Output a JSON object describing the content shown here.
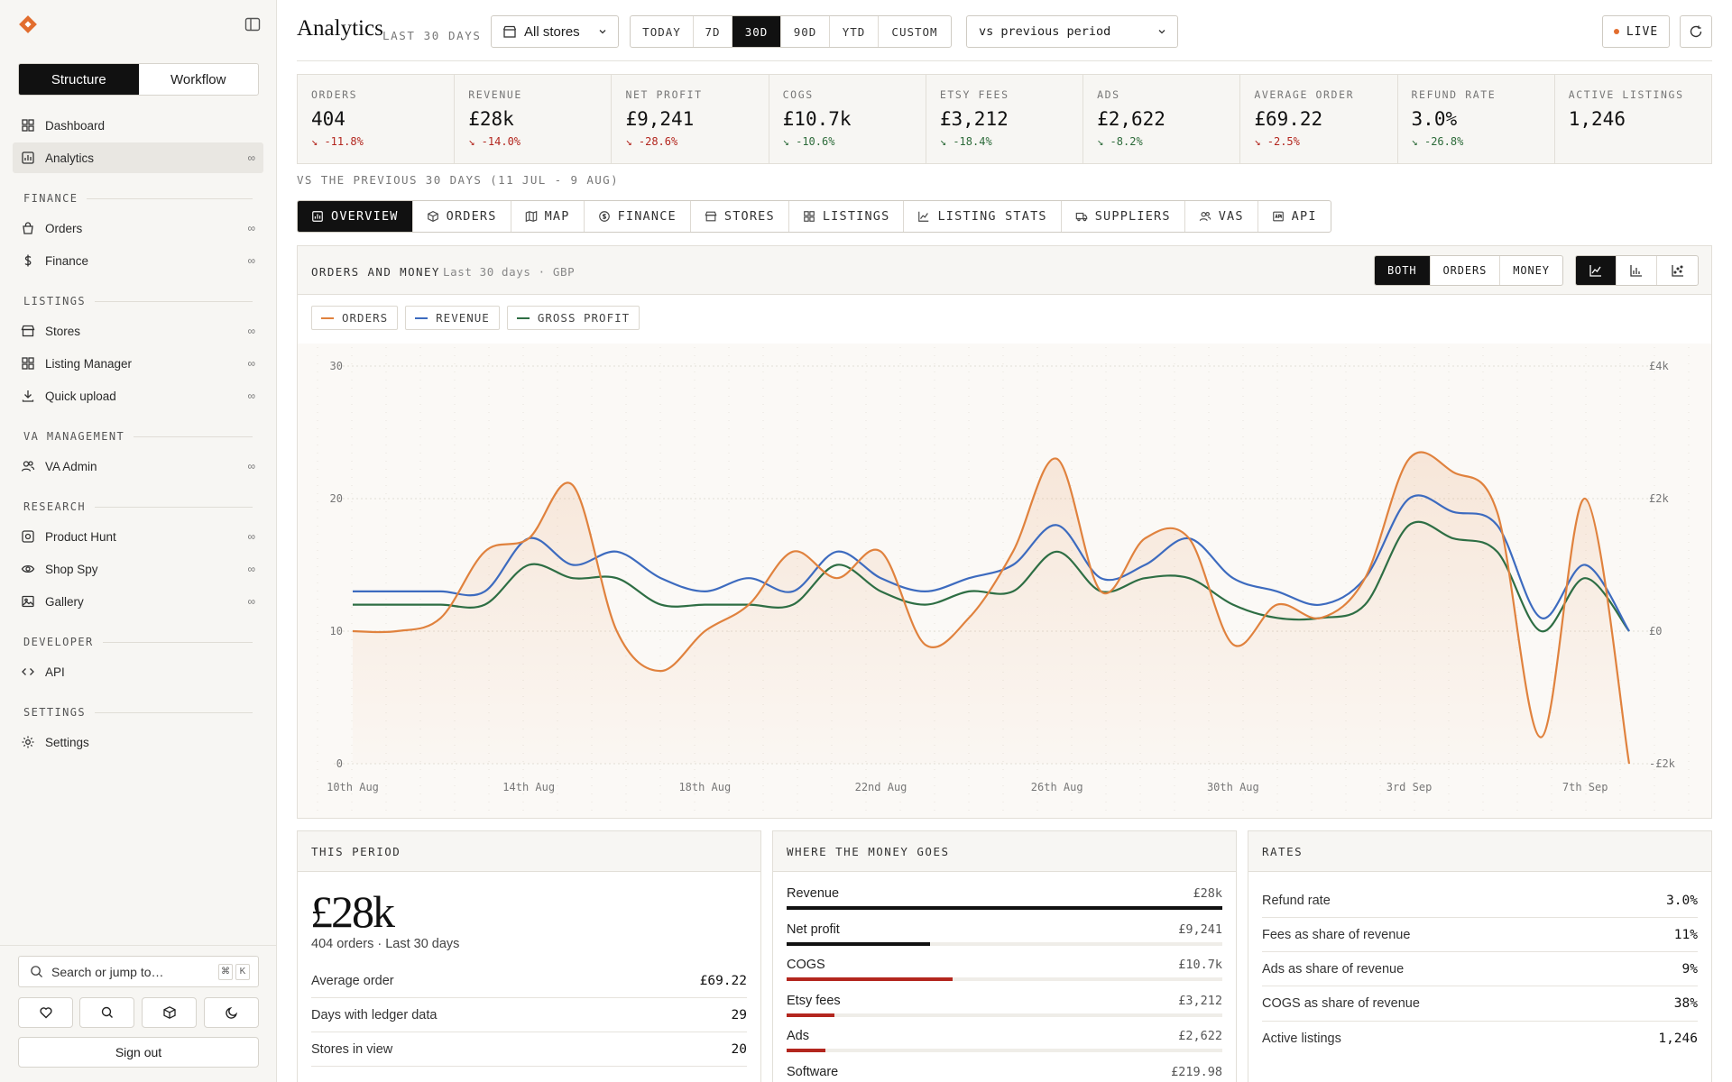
{
  "sidebar": {
    "modes": [
      "Structure",
      "Workflow"
    ],
    "active_mode": 0,
    "top_items": [
      {
        "label": "Dashboard",
        "icon": "grid-icon",
        "badge": ""
      },
      {
        "label": "Analytics",
        "icon": "chart-icon",
        "badge": "∞",
        "active": true
      }
    ],
    "sections": [
      {
        "title": "FINANCE",
        "items": [
          {
            "label": "Orders",
            "icon": "bag-icon",
            "badge": "∞"
          },
          {
            "label": "Finance",
            "icon": "dollar-icon",
            "badge": "∞"
          }
        ]
      },
      {
        "title": "LISTINGS",
        "items": [
          {
            "label": "Stores",
            "icon": "store-icon",
            "badge": "∞"
          },
          {
            "label": "Listing Manager",
            "icon": "grid-icon",
            "badge": "∞"
          },
          {
            "label": "Quick upload",
            "icon": "download-icon",
            "badge": "∞"
          }
        ]
      },
      {
        "title": "VA MANAGEMENT",
        "items": [
          {
            "label": "VA Admin",
            "icon": "users-icon",
            "badge": "∞"
          }
        ]
      },
      {
        "title": "RESEARCH",
        "items": [
          {
            "label": "Product Hunt",
            "icon": "target-icon",
            "badge": "∞"
          },
          {
            "label": "Shop Spy",
            "icon": "eye-icon",
            "badge": "∞"
          },
          {
            "label": "Gallery",
            "icon": "image-icon",
            "badge": "∞"
          }
        ]
      },
      {
        "title": "DEVELOPER",
        "items": [
          {
            "label": "API",
            "icon": "code-icon",
            "badge": ""
          }
        ]
      },
      {
        "title": "SETTINGS",
        "items": [
          {
            "label": "Settings",
            "icon": "gear-icon",
            "badge": ""
          }
        ]
      }
    ],
    "search_placeholder": "Search or jump to…",
    "search_keys": [
      "⌘",
      "K"
    ],
    "quick_icons": [
      "heart-icon",
      "search-icon",
      "box-icon",
      "moon-icon"
    ],
    "signout_label": "Sign out"
  },
  "header": {
    "title": "Analytics",
    "subtitle": "LAST 30 DAYS",
    "store_select": "All stores",
    "ranges": [
      "TODAY",
      "7D",
      "30D",
      "90D",
      "YTD",
      "CUSTOM"
    ],
    "active_range": 2,
    "compare_select": "vs previous period",
    "live_label": "LIVE"
  },
  "kpis": [
    {
      "label": "ORDERS",
      "value": "404",
      "delta": "↘ -11.8%",
      "trend": "red"
    },
    {
      "label": "REVENUE",
      "value": "£28k",
      "delta": "↘ -14.0%",
      "trend": "red"
    },
    {
      "label": "NET PROFIT",
      "value": "£9,241",
      "delta": "↘ -28.6%",
      "trend": "red"
    },
    {
      "label": "COGS",
      "value": "£10.7k",
      "delta": "↘ -10.6%",
      "trend": "green"
    },
    {
      "label": "ETSY FEES",
      "value": "£3,212",
      "delta": "↘ -18.4%",
      "trend": "green"
    },
    {
      "label": "ADS",
      "value": "£2,622",
      "delta": "↘ -8.2%",
      "trend": "green"
    },
    {
      "label": "AVERAGE ORDER",
      "value": "£69.22",
      "delta": "↘ -2.5%",
      "trend": "red"
    },
    {
      "label": "REFUND RATE",
      "value": "3.0%",
      "delta": "↘ -26.8%",
      "trend": "green"
    },
    {
      "label": "ACTIVE LISTINGS",
      "value": "1,246",
      "delta": "",
      "trend": ""
    }
  ],
  "compare_note": "VS THE PREVIOUS 30 DAYS (11 JUL - 9 AUG)",
  "tabs": [
    {
      "label": "OVERVIEW",
      "icon": "overview-icon",
      "active": true
    },
    {
      "label": "ORDERS",
      "icon": "box-icon"
    },
    {
      "label": "MAP",
      "icon": "map-icon"
    },
    {
      "label": "FINANCE",
      "icon": "coin-icon"
    },
    {
      "label": "STORES",
      "icon": "store-icon"
    },
    {
      "label": "LISTINGS",
      "icon": "grid-icon"
    },
    {
      "label": "LISTING STATS",
      "icon": "line-chart-icon"
    },
    {
      "label": "SUPPLIERS",
      "icon": "truck-icon"
    },
    {
      "label": "VAS",
      "icon": "users-icon"
    },
    {
      "label": "API",
      "icon": "api-icon"
    }
  ],
  "chart_panel": {
    "title": "ORDERS AND MONEY",
    "subtitle": "Last 30 days · GBP",
    "metric_modes": [
      "BOTH",
      "ORDERS",
      "MONEY"
    ],
    "active_metric": 0,
    "chart_types": [
      "line-chart-icon",
      "bar-chart-icon",
      "scatter-chart-icon"
    ],
    "active_type": 0
  },
  "chart_data": {
    "type": "line",
    "x": [
      "10th Aug",
      "11th Aug",
      "12th Aug",
      "13th Aug",
      "14th Aug",
      "15th Aug",
      "16th Aug",
      "17th Aug",
      "18th Aug",
      "19th Aug",
      "20th Aug",
      "21st Aug",
      "22nd Aug",
      "23rd Aug",
      "24th Aug",
      "25th Aug",
      "26th Aug",
      "27th Aug",
      "28th Aug",
      "29th Aug",
      "30th Aug",
      "31st Aug",
      "1st Sep",
      "2nd Sep",
      "3rd Sep",
      "4th Sep",
      "5th Sep",
      "6th Sep",
      "7th Sep",
      "8th Sep"
    ],
    "xticks": [
      "10th Aug",
      "14th Aug",
      "18th Aug",
      "22nd Aug",
      "26th Aug",
      "30th Aug",
      "3rd Sep",
      "7th Sep"
    ],
    "y_left": {
      "ticks": [
        0,
        10,
        20,
        30
      ],
      "range": [
        0,
        30
      ]
    },
    "y_right": {
      "ticks": [
        "£4k",
        "£2k",
        "£0",
        "-£2k"
      ],
      "range": [
        -2000,
        4000
      ]
    },
    "grid": true,
    "series": [
      {
        "name": "ORDERS",
        "axis": "left",
        "color": "#e0823e",
        "fill": true,
        "values": [
          10,
          10,
          11,
          16,
          17,
          21,
          10,
          7,
          10,
          12,
          16,
          14,
          16,
          9,
          11,
          16,
          23,
          13,
          17,
          17,
          9,
          12,
          11,
          14,
          23,
          22,
          19,
          2,
          20,
          0
        ]
      },
      {
        "name": "REVENUE",
        "axis": "left",
        "color": "#3d6bbf",
        "fill": false,
        "values": [
          13,
          13,
          13,
          13,
          17,
          15,
          16,
          14,
          13,
          14,
          13,
          16,
          14,
          13,
          14,
          15,
          18,
          14,
          15,
          17,
          14,
          13,
          12,
          14,
          20,
          19,
          18,
          11,
          15,
          10
        ]
      },
      {
        "name": "GROSS PROFIT",
        "axis": "left",
        "color": "#2e6e44",
        "fill": false,
        "values": [
          12,
          12,
          12,
          12,
          15,
          14,
          14,
          12,
          12,
          12,
          12,
          15,
          13,
          12,
          13,
          13,
          16,
          13,
          14,
          14,
          12,
          11,
          11,
          12,
          18,
          17,
          16,
          10,
          14,
          10
        ]
      }
    ]
  },
  "this_period": {
    "title": "THIS PERIOD",
    "value": "£28k",
    "caption": "404 orders · Last 30 days",
    "rows": [
      {
        "label": "Average order",
        "value": "£69.22"
      },
      {
        "label": "Days with ledger data",
        "value": "29"
      },
      {
        "label": "Stores in view",
        "value": "20"
      }
    ]
  },
  "money_goes": {
    "title": "WHERE THE MONEY GOES",
    "rows": [
      {
        "label": "Revenue",
        "amount": "£28k",
        "share": 1.0,
        "color": "#111111"
      },
      {
        "label": "Net profit",
        "amount": "£9,241",
        "share": 0.33,
        "color": "#111111"
      },
      {
        "label": "COGS",
        "amount": "£10.7k",
        "share": 0.38,
        "color": "#b3261e"
      },
      {
        "label": "Etsy fees",
        "amount": "£3,212",
        "share": 0.11,
        "color": "#b3261e"
      },
      {
        "label": "Ads",
        "amount": "£2,622",
        "share": 0.09,
        "color": "#b3261e"
      },
      {
        "label": "Software",
        "amount": "£219.98",
        "share": 0.01,
        "color": "#b3261e"
      }
    ]
  },
  "rates": {
    "title": "RATES",
    "rows": [
      {
        "label": "Refund rate",
        "value": "3.0%"
      },
      {
        "label": "Fees as share of revenue",
        "value": "11%"
      },
      {
        "label": "Ads as share of revenue",
        "value": "9%"
      },
      {
        "label": "COGS as share of revenue",
        "value": "38%"
      },
      {
        "label": "Active listings",
        "value": "1,246"
      }
    ]
  }
}
